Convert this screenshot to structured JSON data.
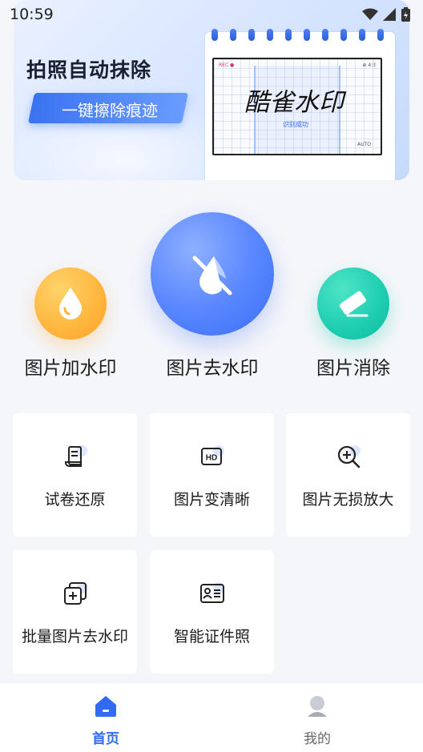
{
  "status_bar": {
    "time": "10:59"
  },
  "banner": {
    "title": "拍照自动抹除",
    "pill_text": "一键擦除痕迹",
    "photo_text": "酷雀水印",
    "photo_subtext": "识别成功",
    "tag_top_left": "REC ●",
    "tag_top_right": "⊕ 4:3",
    "tag_bottom_right": "AUTO"
  },
  "main_actions": [
    {
      "label": "图片加水印",
      "icon": "water-drop-icon",
      "color": "#ffb53c"
    },
    {
      "label": "图片去水印",
      "icon": "water-drop-off-icon",
      "color": "#5b88ff"
    },
    {
      "label": "图片消除",
      "icon": "eraser-icon",
      "color": "#1dcdb0"
    }
  ],
  "tools": [
    {
      "label": "试卷还原",
      "icon": "exam-paper-icon"
    },
    {
      "label": "图片变清晰",
      "icon": "hd-icon"
    },
    {
      "label": "图片无损放大",
      "icon": "zoom-in-icon"
    },
    {
      "label": "批量图片去水印",
      "icon": "batch-images-icon"
    },
    {
      "label": "智能证件照",
      "icon": "id-card-icon"
    }
  ],
  "tabbar": {
    "home_label": "首页",
    "mine_label": "我的",
    "active_color": "#2f6cf2"
  }
}
